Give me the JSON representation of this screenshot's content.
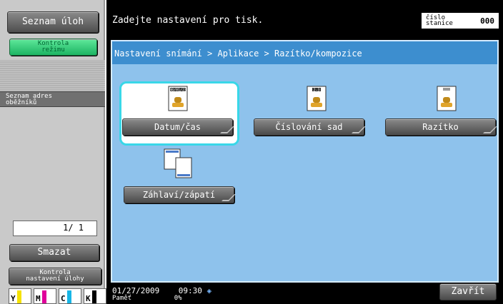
{
  "sidebar": {
    "jobs_label": "Seznam úloh",
    "mode_check_label_line1": "Kontrola",
    "mode_check_label_line2": "režimu",
    "address_tab_line1": "Seznam adres",
    "address_tab_line2": "oběžníků",
    "page_counter": "1/  1",
    "delete_label": "Smazat",
    "check_job_line1": "Kontrola",
    "check_job_line2": "nastavení úlohy",
    "toner": [
      {
        "label": "Y",
        "color": "#f5e200",
        "level": 1.0
      },
      {
        "label": "M",
        "color": "#e0009a",
        "level": 1.0
      },
      {
        "label": "C",
        "color": "#18b6e6",
        "level": 1.0
      },
      {
        "label": "K",
        "color": "#000000",
        "level": 1.0
      }
    ]
  },
  "header": {
    "message": "Zadejte nastavení pro tisk.",
    "station_label_line1": "číslo",
    "station_label_line2": "stanice",
    "station_number": "000"
  },
  "panel": {
    "breadcrumb": "Nastavení snímání > Aplikace > Razítko/kompozice",
    "functions": [
      {
        "label": "Datum/čas",
        "icon": "date-time-stamp-icon",
        "icon_text": "08/01/23",
        "selected": true
      },
      {
        "label": "Číslování sad",
        "icon": "set-numbering-stamp-icon",
        "icon_text": "2-3",
        "selected": false
      },
      {
        "label": "Razítko",
        "icon": "stamp-icon",
        "icon_text": "",
        "selected": false
      },
      {
        "label": "Záhlaví/zápatí",
        "icon": "header-footer-icon",
        "icon_text": "",
        "selected": false
      }
    ]
  },
  "status": {
    "date": "01/27/2009",
    "time": "09:30",
    "memory_label": "Paměť",
    "memory_value": "0%"
  },
  "footer": {
    "close_label": "Zavřít"
  }
}
